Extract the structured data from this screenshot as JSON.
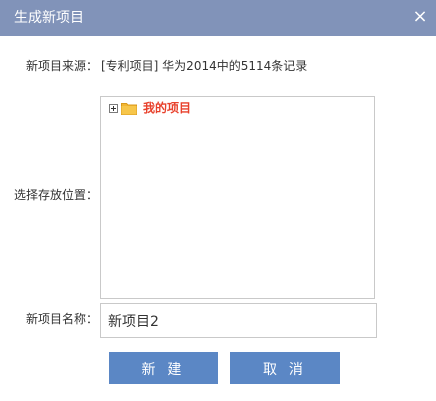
{
  "dialog": {
    "title": "生成新项目",
    "close_glyph": "×"
  },
  "form": {
    "source": {
      "label": "新项目来源：",
      "value": "[专利项目] 华为2014中的5114条记录"
    },
    "location": {
      "label": "选择存放位置：",
      "tree": [
        {
          "label": "我的项目",
          "icon": "folder-icon",
          "expanded": false
        }
      ]
    },
    "name": {
      "label": "新项目名称：",
      "value": "新项目2"
    }
  },
  "buttons": {
    "create_label": "新 建",
    "cancel_label": "取 消"
  },
  "colors": {
    "titlebar": "#8193b9",
    "button": "#5b87c5",
    "tree_node_text": "#e8412c",
    "folder": "#f2b632"
  }
}
